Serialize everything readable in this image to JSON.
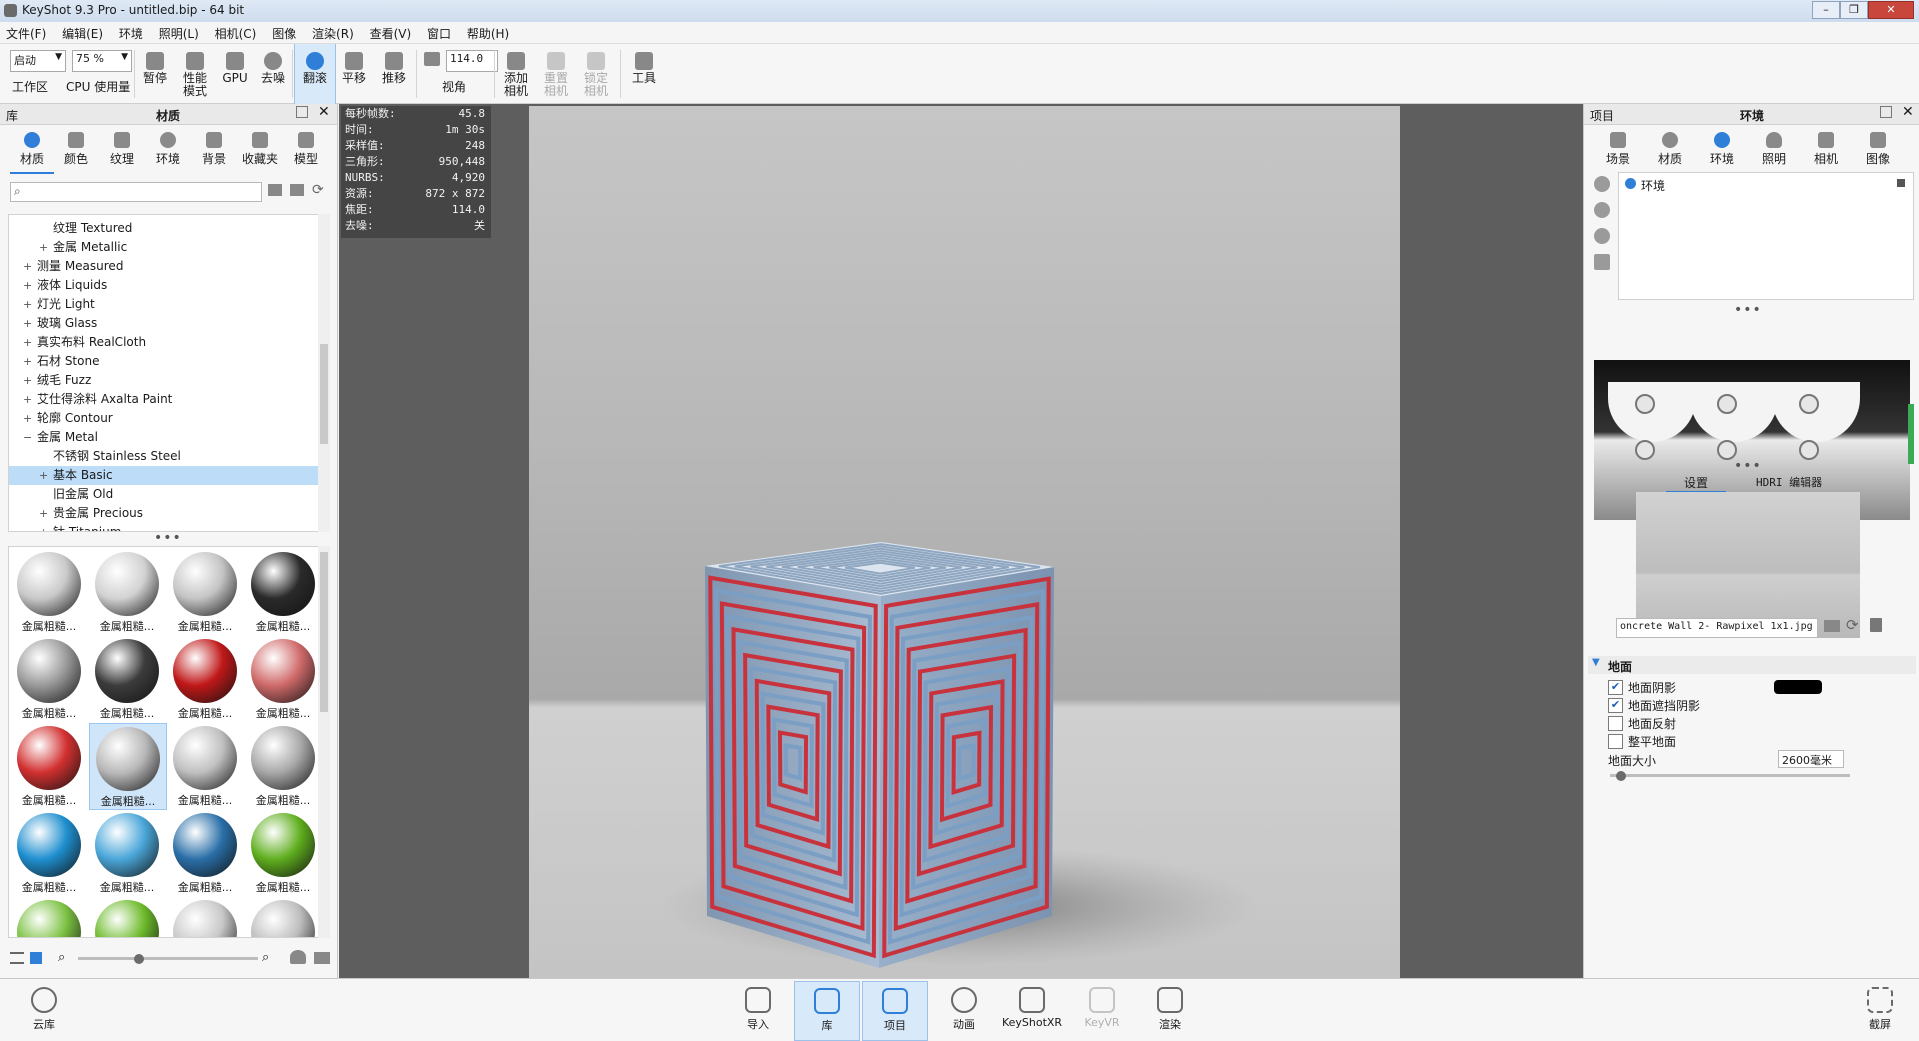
{
  "window": {
    "title": "KeyShot 9.3 Pro  - untitled.bip  - 64 bit",
    "min": "–",
    "max": "❐",
    "close": "✕"
  },
  "menu": [
    "文件(F)",
    "编辑(E)",
    "环境",
    "照明(L)",
    "相机(C)",
    "图像",
    "渲染(R)",
    "查看(V)",
    "窗口",
    "帮助(H)"
  ],
  "toolbar": {
    "workspace_value": "启动",
    "workspace_label": "工作区",
    "cpu_value": "75 %",
    "cpu_label": "CPU 使用量",
    "pause": "暂停",
    "perf": "性能\n模式",
    "gpu": "GPU",
    "denoise": "去噪",
    "tumble": "翻滚",
    "pan": "平移",
    "dolly": "推移",
    "fov_value": "114.0",
    "fov_label": "视角",
    "add_camera": "添加\n相机",
    "reset_camera": "重置\n相机",
    "lock_camera": "锁定\n相机",
    "tools": "工具"
  },
  "library": {
    "header_left": "库",
    "header_title": "材质",
    "tabs": [
      "材质",
      "颜色",
      "纹理",
      "环境",
      "背景",
      "收藏夹",
      "模型"
    ],
    "tree": [
      {
        "label": "纹理 Textured",
        "indent": 2,
        "pm": ""
      },
      {
        "label": "金属 Metallic",
        "indent": 2,
        "pm": "+"
      },
      {
        "label": "测量 Measured",
        "indent": 1,
        "pm": "+"
      },
      {
        "label": "液体 Liquids",
        "indent": 1,
        "pm": "+"
      },
      {
        "label": "灯光 Light",
        "indent": 1,
        "pm": "+"
      },
      {
        "label": "玻璃 Glass",
        "indent": 1,
        "pm": "+"
      },
      {
        "label": "真实布料 RealCloth",
        "indent": 1,
        "pm": "+"
      },
      {
        "label": "石材 Stone",
        "indent": 1,
        "pm": "+"
      },
      {
        "label": "绒毛 Fuzz",
        "indent": 1,
        "pm": "+"
      },
      {
        "label": "艾仕得涂料 Axalta Paint",
        "indent": 1,
        "pm": "+"
      },
      {
        "label": "轮廓 Contour",
        "indent": 1,
        "pm": "+"
      },
      {
        "label": "金属 Metal",
        "indent": 1,
        "pm": "−"
      },
      {
        "label": "不锈钢 Stainless Steel",
        "indent": 2,
        "pm": ""
      },
      {
        "label": "基本 Basic",
        "indent": 2,
        "pm": "+",
        "selected": true
      },
      {
        "label": "旧金属 Old",
        "indent": 2,
        "pm": ""
      },
      {
        "label": "贵金属 Precious",
        "indent": 2,
        "pm": "+"
      },
      {
        "label": "钛 Titanium",
        "indent": 2,
        "pm": "+"
      }
    ],
    "thumb_label": "金属粗糙...",
    "thumbs": [
      {
        "color": "#c9c9c9"
      },
      {
        "color": "#d2d2d2"
      },
      {
        "color": "#c4c4c4"
      },
      {
        "color": "#2a2a2a"
      },
      {
        "color": "#9a9a9a"
      },
      {
        "color": "#3c3c3c"
      },
      {
        "color": "#c01818"
      },
      {
        "color": "#d06a6a"
      },
      {
        "color": "#d23030"
      },
      {
        "color": "#b8b8b8",
        "selected": true
      },
      {
        "color": "#c0c0c0"
      },
      {
        "color": "#a9a9a9"
      },
      {
        "color": "#1f8fcf"
      },
      {
        "color": "#4aa6d9"
      },
      {
        "color": "#2a6fa8"
      },
      {
        "color": "#5fae1e"
      },
      {
        "color": "#7bc142"
      },
      {
        "color": "#6cba2a"
      },
      {
        "color": "#c8c8c8"
      },
      {
        "color": "#bdbdbd"
      }
    ]
  },
  "hud": [
    {
      "k": "每秒帧数:",
      "v": "45.8"
    },
    {
      "k": "时间:",
      "v": "1m 30s"
    },
    {
      "k": "采样值:",
      "v": "248"
    },
    {
      "k": "三角形:",
      "v": "950,448"
    },
    {
      "k": "NURBS:",
      "v": "4,920"
    },
    {
      "k": "资源:",
      "v": "872 x 872"
    },
    {
      "k": "焦距:",
      "v": "114.0"
    },
    {
      "k": "去噪:",
      "v": "关"
    }
  ],
  "project": {
    "header_left": "项目",
    "header_title": "环境",
    "tabs": [
      "场景",
      "材质",
      "环境",
      "照明",
      "相机",
      "图像"
    ],
    "env_item": "环境",
    "subtabs": [
      "设置",
      "HDRI 编辑器"
    ],
    "file": "oncrete Wall 2- Rawpixel 1x1.jpg",
    "ground_title": "地面",
    "ground_options": [
      {
        "label": "地面阴影",
        "checked": true
      },
      {
        "label": "地面遮挡阴影",
        "checked": true
      },
      {
        "label": "地面反射",
        "checked": false
      },
      {
        "label": "整平地面",
        "checked": false
      }
    ],
    "ground_size_label": "地面大小",
    "ground_size_value": "2600毫米",
    "shadow_color": "#000000"
  },
  "bottom": {
    "cloud": "云库",
    "import": "导入",
    "library": "库",
    "project": "项目",
    "animation": "动画",
    "keyshotxr": "KeyShotXR",
    "keyvr": "KeyVR",
    "render": "渲染",
    "screenshot": "截屏"
  },
  "colors": {
    "accent": "#2f7fd8",
    "cube_red": "#c8323c",
    "cube_blue": "#7a9ec4"
  }
}
